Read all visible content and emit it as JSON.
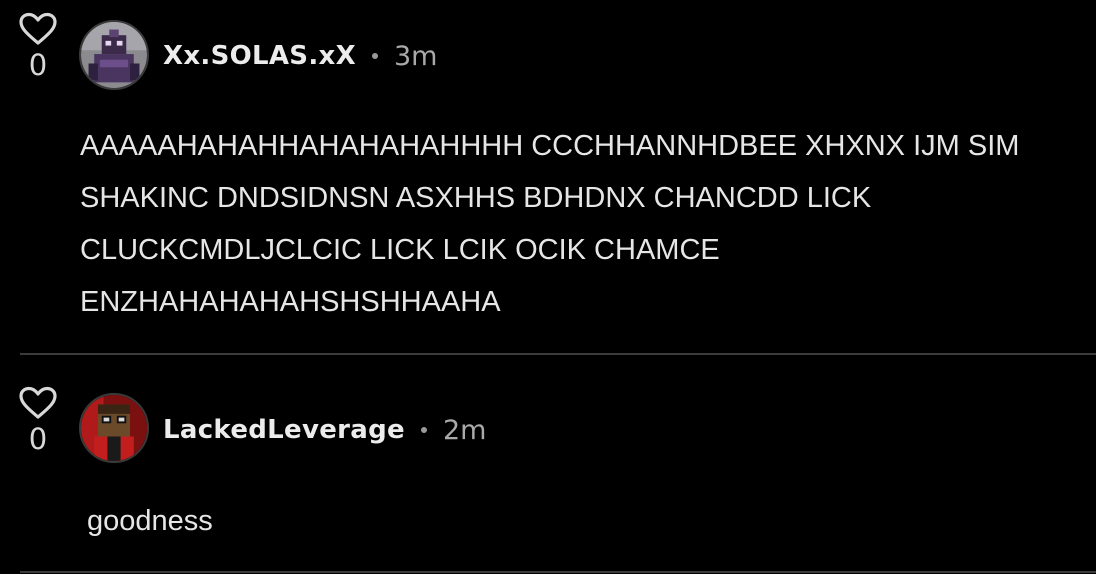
{
  "comments": [
    {
      "username": "Xx.SOLAS.xX",
      "time": "3m",
      "likes": "0",
      "avatar_icon": "purple-character-avatar",
      "text": "AAAAAHAHAHHAHAHAHAHHHH CCCHHANNHDBEE XHXNX IJM SIM SHAKINC DNDSIDNSN ASXHHS BDHDNX CHANCDD LICK CLUCKCMDLJCLCIC LICK LCIK OCIK CHAMCE ENZHAHAHAHAHSHSHHAAHA"
    },
    {
      "username": "LackedLeverage",
      "time": "2m",
      "likes": "0",
      "avatar_icon": "red-blocky-character-avatar",
      "text": "goodness"
    }
  ],
  "colors": {
    "background": "#000000",
    "text": "#e6e6e6",
    "muted": "#a9a9a9",
    "divider": "#3b3b3b"
  }
}
